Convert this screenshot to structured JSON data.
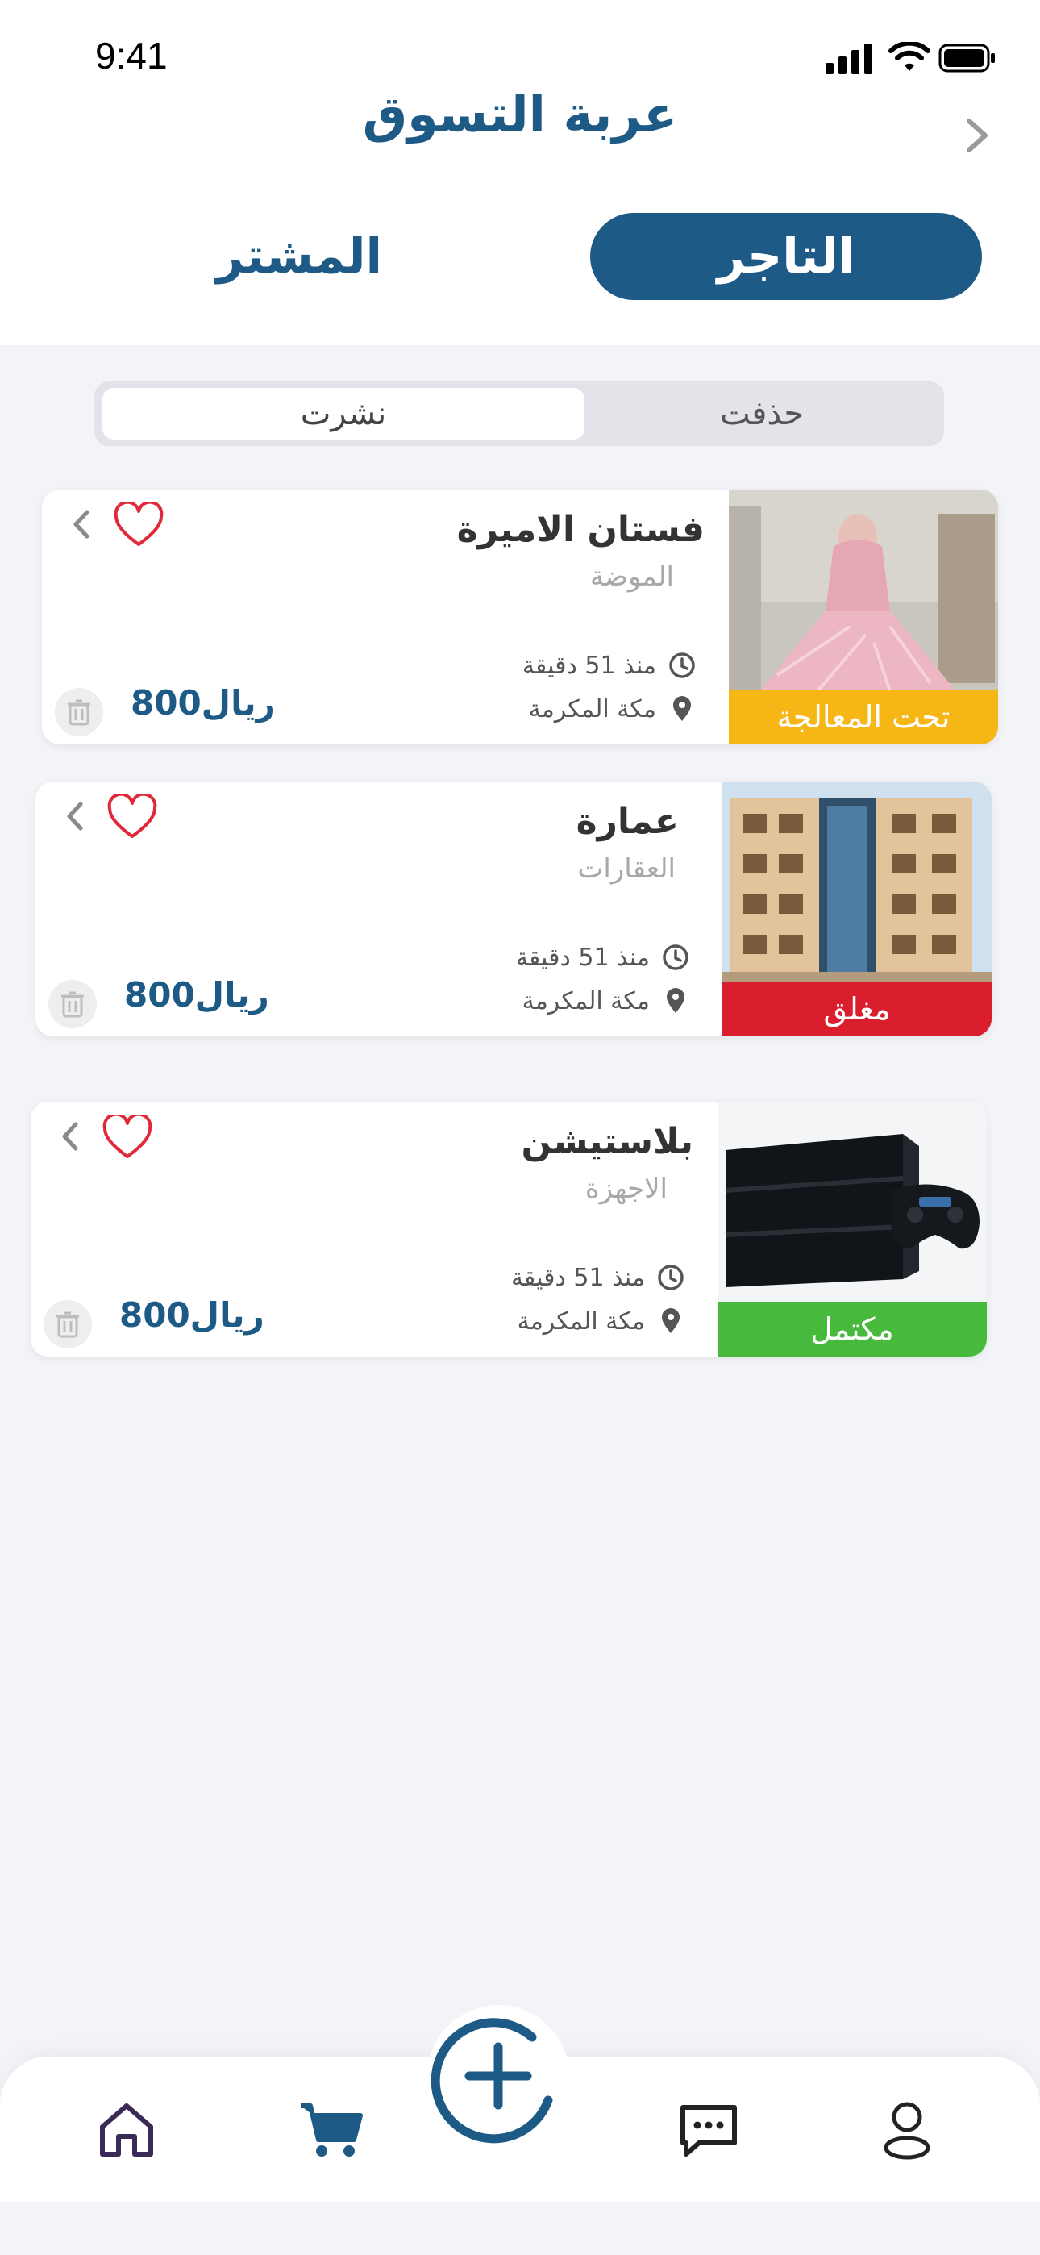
{
  "status_bar": {
    "time": "9:41"
  },
  "header": {
    "title": "عربة التسوق"
  },
  "role_tabs": {
    "merchant": "التاجر",
    "buyer": "المشتر"
  },
  "segment": {
    "published": "نشرت",
    "deleted": "حذفت"
  },
  "colors": {
    "primary": "#1e5a86",
    "processing": "#f5b616",
    "closed": "#db1e2d",
    "complete": "#47b93c",
    "heart": "#e02a3a"
  },
  "cards": [
    {
      "title": "فستان الاميرة",
      "category": "الموضة",
      "time": "منذ 51 دقيقة",
      "location": "مكة المكرمة",
      "price": "800ريال",
      "status": "تحت المعالجة",
      "image_icon": "dress-photo"
    },
    {
      "title": "عمارة",
      "category": "العقارات",
      "time": "منذ 51 دقيقة",
      "location": "مكة المكرمة",
      "price": "800ريال",
      "status": "مغلق",
      "image_icon": "building-photo"
    },
    {
      "title": "بلاستيشن",
      "category": "الاجهزة",
      "time": "منذ 51 دقيقة",
      "location": "مكة المكرمة",
      "price": "800ريال",
      "status": "مكتمل",
      "image_icon": "console-photo"
    }
  ],
  "bottom_nav": {
    "items": [
      "home-icon",
      "cart-icon",
      "add-icon",
      "chat-icon",
      "profile-icon"
    ]
  }
}
